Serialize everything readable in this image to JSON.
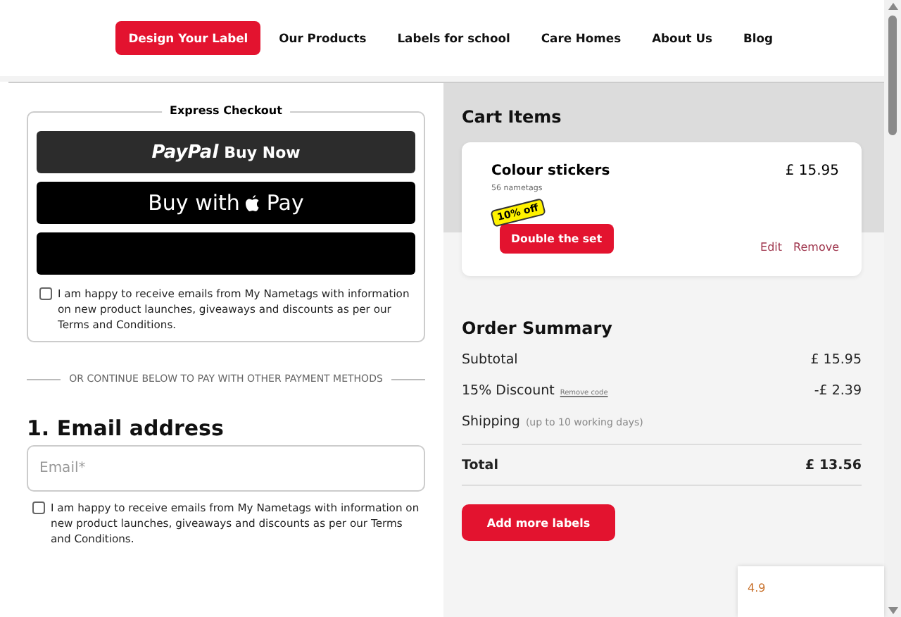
{
  "nav": [
    {
      "label": "Design Your Label",
      "selected": true
    },
    {
      "label": "Our Products",
      "selected": false
    },
    {
      "label": "Labels for school",
      "selected": false
    },
    {
      "label": "Care Homes",
      "selected": false
    },
    {
      "label": "About Us",
      "selected": false
    },
    {
      "label": "Blog",
      "selected": false
    }
  ],
  "express_checkout": {
    "title": "Express Checkout",
    "buttons": [
      {
        "kind": "paypal",
        "brand": "PayPal",
        "label": "Buy Now"
      },
      {
        "kind": "applepay",
        "label": "Buy with",
        "suffix": "Pay"
      },
      {
        "kind": "blank"
      }
    ],
    "consent": {
      "checked": false,
      "text": "I am happy to receive emails from My Nametags with information on new product launches, giveaways and discounts as per our Terms and Conditions."
    }
  },
  "separator": "OR CONTINUE BELOW TO PAY WITH OTHER PAYMENT METHODS",
  "email_section": {
    "title": "1. Email address",
    "placeholder": "Email*",
    "consent": {
      "checked": false,
      "text": "I am happy to receive emails from My Nametags with information on new product launches, giveaways and discounts as per our Terms and Conditions."
    }
  },
  "cart": {
    "title": "Cart Items",
    "items": [
      {
        "name": "Colour stickers",
        "detail": "56 nametags",
        "price": "£ 15.95",
        "badge": "10% off",
        "upsell": "Double the set",
        "actions": [
          "Edit",
          "Remove"
        ]
      }
    ]
  },
  "order_summary": {
    "title": "Order Summary",
    "rows": [
      {
        "kind": "line",
        "label": "Subtotal",
        "value": "£ 15.95"
      },
      {
        "kind": "discount",
        "label": "15% Discount",
        "link": "Remove code",
        "value": "-£ 2.39"
      },
      {
        "kind": "note",
        "label": "Shipping",
        "note": "(up to 10 working days)"
      },
      {
        "kind": "total",
        "label": "Total",
        "value": "£ 13.56"
      }
    ],
    "button": "Add more labels"
  },
  "rating_widget": {
    "score": "4.9"
  }
}
